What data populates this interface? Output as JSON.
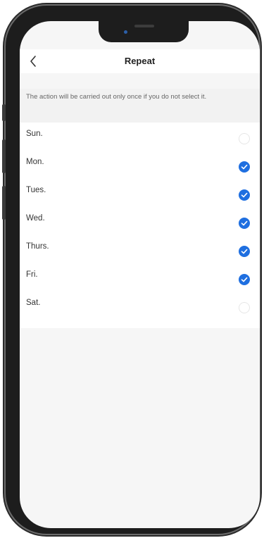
{
  "header": {
    "title": "Repeat",
    "back_icon": "chevron-left-icon"
  },
  "note": {
    "text": "The action will be carried out only once if you do not select it."
  },
  "days": [
    {
      "label": "Sun.",
      "checked": false
    },
    {
      "label": "Mon.",
      "checked": true
    },
    {
      "label": "Tues.",
      "checked": true
    },
    {
      "label": "Wed.",
      "checked": true
    },
    {
      "label": "Thurs.",
      "checked": true
    },
    {
      "label": "Fri.",
      "checked": true
    },
    {
      "label": "Sat.",
      "checked": false
    }
  ],
  "colors": {
    "accent": "#1f6fe0",
    "background": "#f6f6f6"
  }
}
